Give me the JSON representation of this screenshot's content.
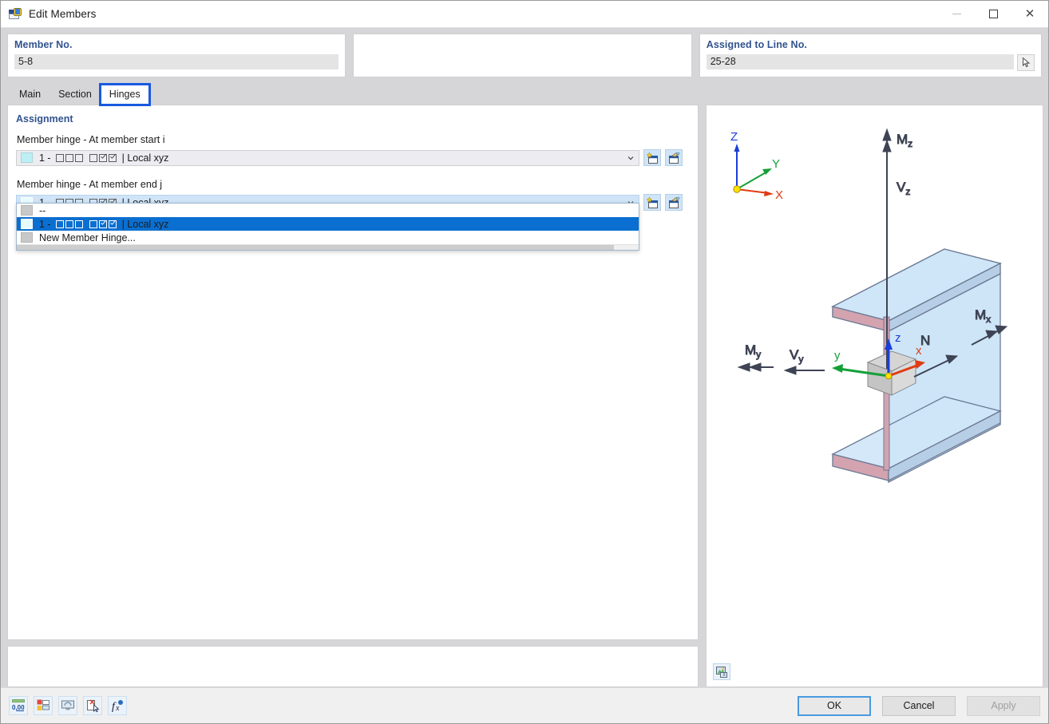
{
  "window": {
    "title": "Edit Members",
    "icon": "member-edit-icon",
    "controls": {
      "minimize": "—",
      "maximize": "□",
      "close": "✕"
    }
  },
  "header": {
    "member_no": {
      "label": "Member No.",
      "value": "5-8"
    },
    "middle": {
      "label": "",
      "value": ""
    },
    "assigned_line": {
      "label": "Assigned to Line No.",
      "value": "25-28",
      "pick_icon": "pick-cursor-icon"
    }
  },
  "tabs": [
    {
      "label": "Main",
      "active": false
    },
    {
      "label": "Section",
      "active": false
    },
    {
      "label": "Hinges",
      "active": true
    }
  ],
  "assignment": {
    "section_title": "Assignment",
    "start": {
      "label": "Member hinge - At member start i",
      "value": "1 -  □□□  □☑☑ | Local xyz",
      "value_prefix": "1 -",
      "value_suffix": "| Local xyz",
      "new_button": "new-member-hinge-button",
      "edit_button": "edit-member-hinge-button"
    },
    "end": {
      "label": "Member hinge - At member end j",
      "value": "1 -  □□□  □☑☑ | Local xyz",
      "value_prefix": "1 -",
      "value_suffix": "| Local xyz",
      "new_button": "new-member-hinge-button",
      "edit_button": "edit-member-hinge-button",
      "expanded": true
    },
    "dropdown_options": [
      {
        "label": "--",
        "prefix": "--",
        "suffix": "",
        "type": "none",
        "selected": false
      },
      {
        "label": "1 -  □□□  □☑☑ | Local xyz",
        "prefix": "1 -",
        "suffix": "| Local xyz",
        "type": "hinge",
        "selected": true
      },
      {
        "label": "New Member Hinge...",
        "prefix": "New Member Hinge...",
        "suffix": "",
        "type": "new",
        "selected": false
      }
    ]
  },
  "visualization": {
    "global_axes": {
      "x": "X",
      "y": "Y",
      "z": "Z"
    },
    "local_axes": {
      "x": "x",
      "y": "y",
      "z": "z"
    },
    "internal_forces": [
      {
        "name": "Mz",
        "kind": "moment"
      },
      {
        "name": "Vz",
        "kind": "force"
      },
      {
        "name": "Mx",
        "kind": "moment"
      },
      {
        "name": "N",
        "kind": "force"
      },
      {
        "name": "My",
        "kind": "moment"
      },
      {
        "name": "Vy",
        "kind": "force"
      }
    ],
    "render_button": "render-preview-icon",
    "colors": {
      "x_axis": "#e03b14",
      "y_axis": "#14a038",
      "z_axis": "#1a3ed8",
      "flange": "#c99aa8",
      "web": "#bddcf5"
    }
  },
  "toolbar": [
    {
      "name": "decimal-places-icon",
      "label": "0.00"
    },
    {
      "name": "units-icon",
      "label": ""
    },
    {
      "name": "display-properties-icon",
      "label": ""
    },
    {
      "name": "deactivate-icon",
      "label": ""
    },
    {
      "name": "formula-icon",
      "label": "f(x)"
    }
  ],
  "footer_buttons": [
    {
      "label": "OK",
      "state": "default-focused",
      "name": "ok-button"
    },
    {
      "label": "Cancel",
      "state": "normal",
      "name": "cancel-button"
    },
    {
      "label": "Apply",
      "state": "disabled",
      "name": "apply-button"
    }
  ]
}
